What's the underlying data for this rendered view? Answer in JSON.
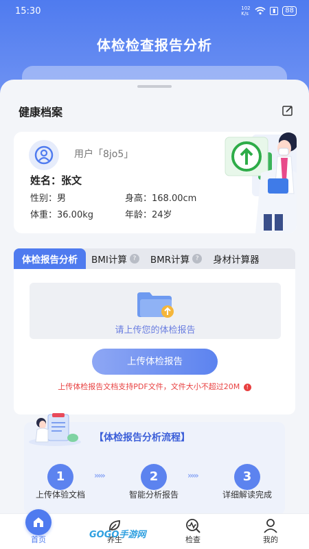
{
  "status_bar": {
    "time": "15:30",
    "net_speed": "102 K/s",
    "battery": "88"
  },
  "header": {
    "title": "体检检查报告分析"
  },
  "health_file": {
    "section_title": "健康档案",
    "user_label": "用户「8jo5」",
    "name_label": "姓名：张文",
    "gender": "性别：男",
    "height": "身高：168.00cm",
    "weight": "体重：36.00kg",
    "age": "年龄：24岁"
  },
  "tabs": [
    {
      "label": "体检报告分析",
      "active": true
    },
    {
      "label": "BMI计算",
      "help": "?"
    },
    {
      "label": "BMR计算",
      "help": "?"
    },
    {
      "label": "身材计算器"
    }
  ],
  "upload": {
    "hint": "请上传您的体检报告",
    "button_label": "上传体检报告",
    "warning": "上传体检报告文档支持PDF文件，文件大小不超过20M",
    "warning_icon": "!"
  },
  "process": {
    "title": "【体检报告分析流程】",
    "steps": [
      {
        "num": "1",
        "label": "上传体验文档"
      },
      {
        "num": "2",
        "label": "智能分析报告"
      },
      {
        "num": "3",
        "label": "详细解读完成"
      }
    ],
    "arrows": "›››››"
  },
  "nav": {
    "items": [
      {
        "label": "首页",
        "icon": "home-icon"
      },
      {
        "label": "养生",
        "icon": "leaf-icon"
      },
      {
        "label": "检查",
        "icon": "inspect-icon"
      },
      {
        "label": "我的",
        "icon": "user-icon"
      }
    ]
  },
  "watermark": "GOGO手游网",
  "colors": {
    "primary": "#4f7bef",
    "warning": "#e84040",
    "process_title": "#3b5ed8"
  }
}
